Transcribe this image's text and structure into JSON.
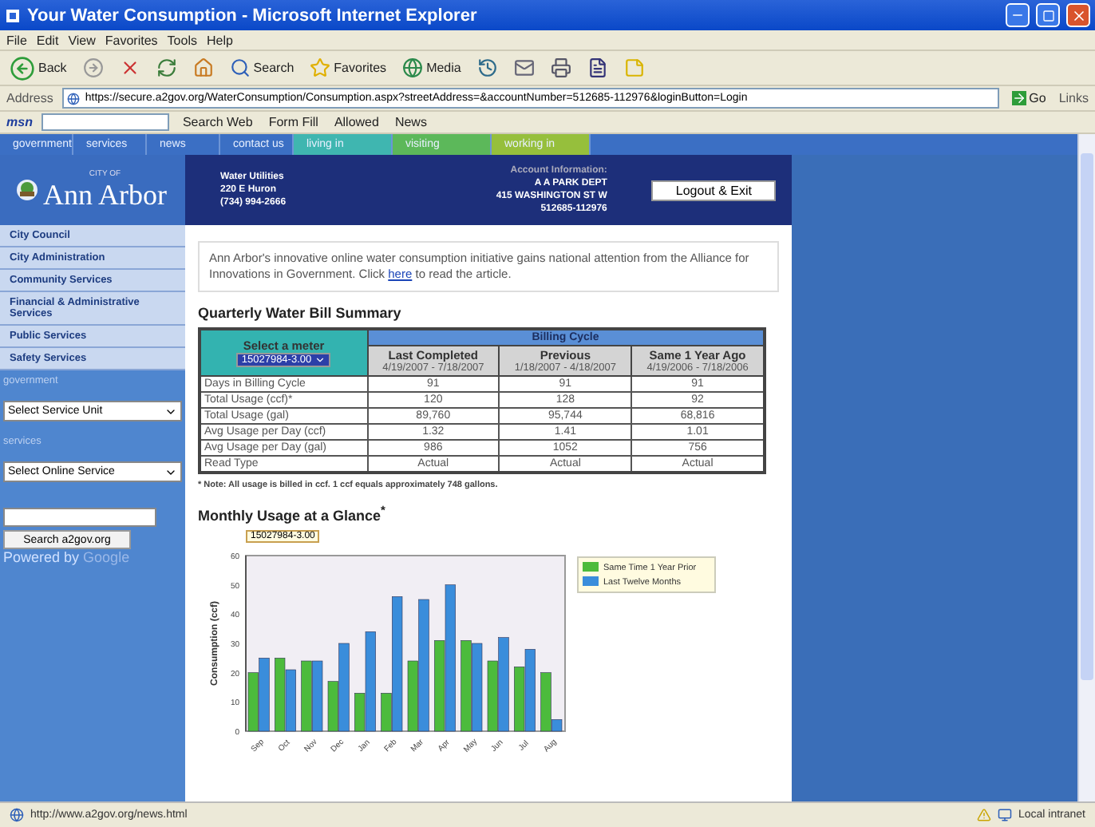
{
  "window": {
    "title": "Your Water Consumption - Microsoft Internet Explorer"
  },
  "menu": [
    "File",
    "Edit",
    "View",
    "Favorites",
    "Tools",
    "Help"
  ],
  "toolbar": [
    {
      "kind": "back",
      "label": "Back"
    },
    {
      "kind": "forward"
    },
    {
      "kind": "stop"
    },
    {
      "kind": "refresh"
    },
    {
      "kind": "home"
    },
    {
      "kind": "search",
      "label": "Search"
    },
    {
      "kind": "favorites",
      "label": "Favorites"
    },
    {
      "kind": "media",
      "label": "Media"
    },
    {
      "kind": "history"
    },
    {
      "kind": "mail"
    },
    {
      "kind": "print"
    },
    {
      "kind": "edit"
    },
    {
      "kind": "note"
    }
  ],
  "address": {
    "label": "Address",
    "url": "https://secure.a2gov.org/WaterConsumption/Consumption.aspx?streetAddress=&accountNumber=512685-112976&loginButton=Login",
    "go": "Go",
    "links": "Links"
  },
  "msn_bar": {
    "logo": "msn",
    "items": [
      "Search Web",
      "Form Fill",
      "Allowed",
      "News"
    ]
  },
  "site_nav": [
    {
      "label": "government",
      "color": "#3b6fc4"
    },
    {
      "label": "services",
      "color": "#3b6fc4"
    },
    {
      "label": "news",
      "color": "#3b6fc4"
    },
    {
      "label": "contact us",
      "color": "#3b6fc4"
    },
    {
      "label": "living in",
      "color": "#3fb6b0"
    },
    {
      "label": "visiting",
      "color": "#5cb85a"
    },
    {
      "label": "working in",
      "color": "#96bf3c"
    }
  ],
  "header": {
    "city_small": "CITY OF",
    "city": "Ann Arbor",
    "department": [
      "Water Utilities",
      "220 E Huron",
      "(734) 994-2666"
    ],
    "account": [
      "Account Information:",
      "A A PARK DEPT",
      "415 WASHINGTON ST W",
      "512685-112976"
    ],
    "logout": "Logout & Exit"
  },
  "sidebar": {
    "links": [
      "City Council",
      "City Administration",
      "Community Services",
      "Financial & Administrative Services",
      "Public Services",
      "Safety Services"
    ],
    "government_label": "government",
    "service_unit": "Select Service Unit",
    "services_label": "services",
    "online_service": "Select Online Service",
    "search_button": "Search a2gov.org",
    "powered_by": "Powered by",
    "powered_brand": "Google"
  },
  "announcement": {
    "before": "Ann Arbor's innovative online water consumption initiative gains national attention from the Alliance for Innovations in Government.   Click ",
    "link": "here",
    "after": " to read the article."
  },
  "summary": {
    "title": "Quarterly Water Bill Summary",
    "meter_label": "Select a meter",
    "meter": "15027984-3.00",
    "cycle_label": "Billing Cycle",
    "columns": [
      {
        "name": "Last Completed",
        "range": "4/19/2007 - 7/18/2007"
      },
      {
        "name": "Previous",
        "range": "1/18/2007 - 4/18/2007"
      },
      {
        "name": "Same 1 Year Ago",
        "range": "4/19/2006 - 7/18/2006"
      }
    ],
    "rows": [
      {
        "label": "Days in Billing Cycle",
        "values": [
          "91",
          "91",
          "91"
        ]
      },
      {
        "label": "Total Usage (ccf)*",
        "values": [
          "120",
          "128",
          "92"
        ]
      },
      {
        "label": "Total Usage (gal)",
        "values": [
          "89,760",
          "95,744",
          "68,816"
        ]
      },
      {
        "label": "Avg Usage per Day (ccf)",
        "values": [
          "1.32",
          "1.41",
          "1.01"
        ]
      },
      {
        "label": "Avg Usage per Day (gal)",
        "values": [
          "986",
          "1052",
          "756"
        ]
      },
      {
        "label": "Read Type",
        "values": [
          "Actual",
          "Actual",
          "Actual"
        ]
      }
    ],
    "note": "* Note: All usage is billed in ccf. 1 ccf equals approximately 748 gallons."
  },
  "usage": {
    "title": "Monthly Usage at a Glance$^{*}$",
    "meter_tag": "15027984-3.00",
    "chart_data": {
      "type": "bar",
      "legend": "right",
      "ylabel": "Consumption (ccf)",
      "categories": [
        "Sep",
        "Oct",
        "Nov",
        "Dec",
        "Jan",
        "Feb",
        "Mar",
        "Apr",
        "May",
        "Jun",
        "Jul",
        "Aug"
      ],
      "ylim": [
        0,
        60
      ],
      "yticks": [
        0,
        10,
        20,
        30,
        40,
        50,
        60
      ],
      "series": [
        {
          "name": "Same Time 1 Year Prior",
          "color": "#4cbb3c",
          "values": [
            20,
            25,
            24,
            17,
            13,
            13,
            24,
            31,
            31,
            24,
            22,
            20
          ]
        },
        {
          "name": "Last Twelve Months",
          "color": "#3a8ddb",
          "values": [
            25,
            21,
            24,
            30,
            34,
            46,
            45,
            50,
            30,
            32,
            28,
            4
          ]
        }
      ]
    }
  },
  "status_bar": {
    "url": "http://www.a2gov.org/news.html",
    "zone": "Local intranet"
  }
}
